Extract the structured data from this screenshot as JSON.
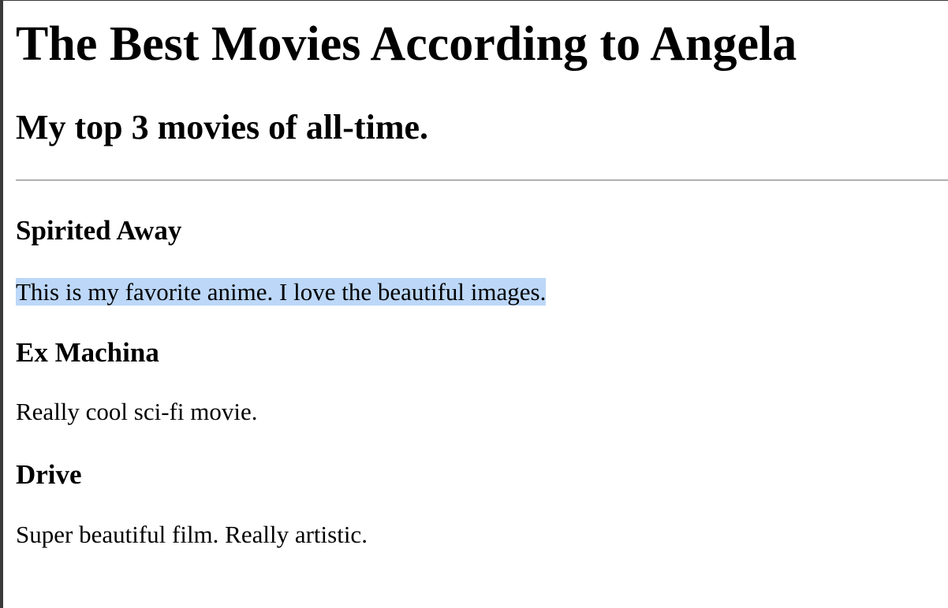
{
  "page": {
    "title": "The Best Movies According to Angela",
    "subtitle": "My top 3 movies of all-time."
  },
  "movies": [
    {
      "title": "Spirited Away",
      "description": "This is my favorite anime. I love the beautiful images.",
      "selected": true
    },
    {
      "title": "Ex Machina",
      "description": "Really cool sci-fi movie.",
      "selected": false
    },
    {
      "title": "Drive",
      "description": "Super beautiful film. Really artistic.",
      "selected": false
    }
  ],
  "colors": {
    "text": "#000000",
    "selection_highlight": "#bcd7f8",
    "divider": "#8e8e8e",
    "background": "#ffffff"
  }
}
